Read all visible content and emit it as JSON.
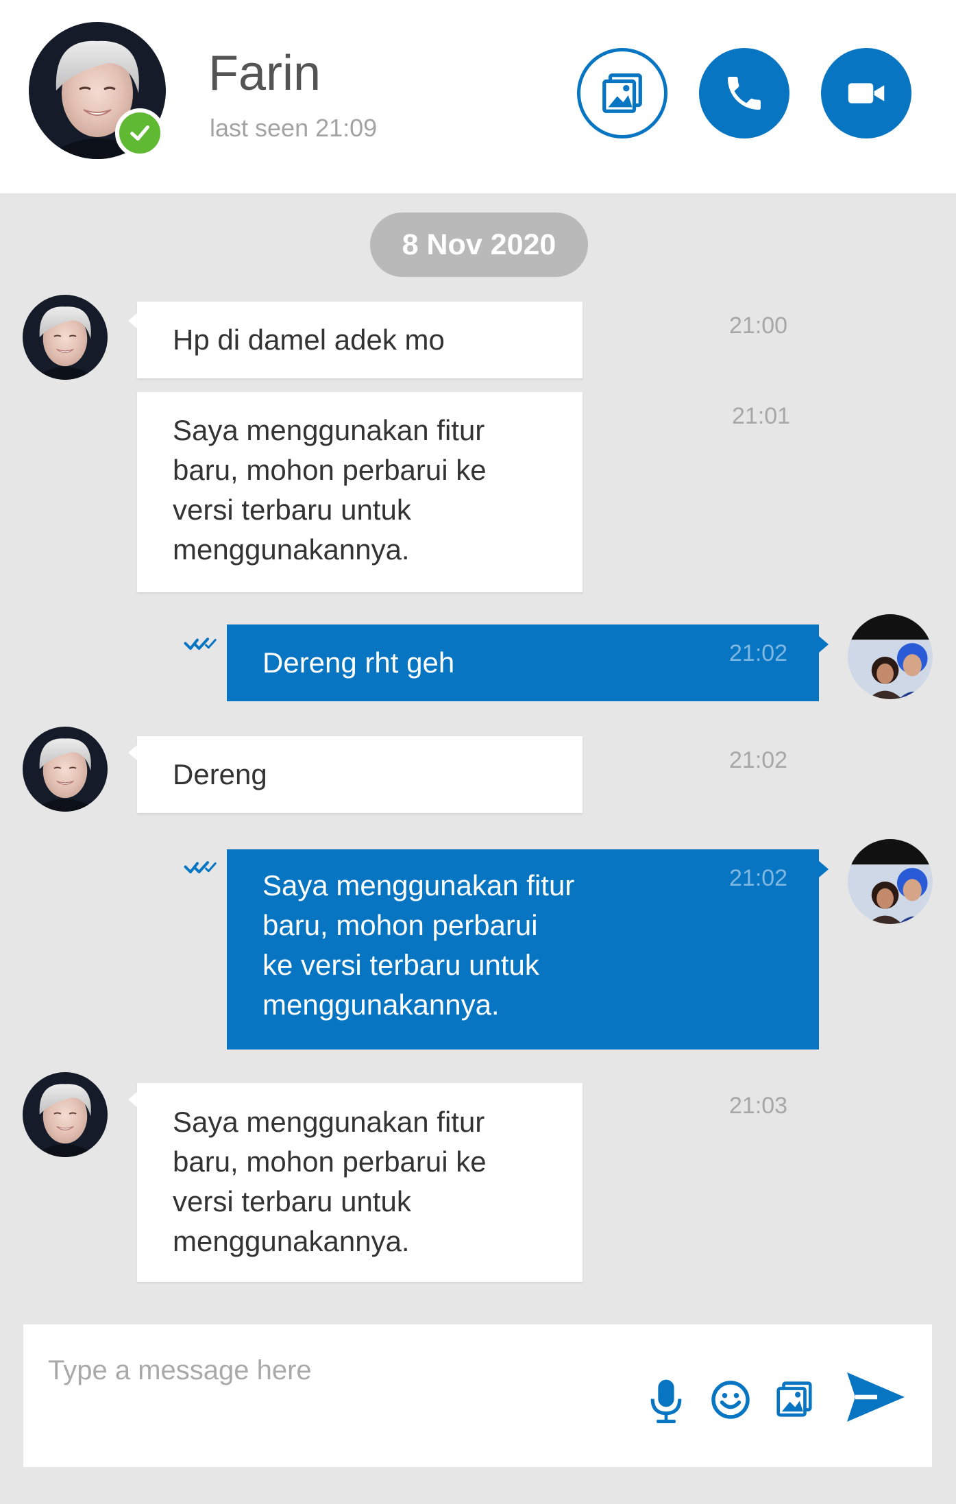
{
  "header": {
    "name": "Farin",
    "last_seen": "last seen 21:09",
    "online_status": "online",
    "buttons": [
      {
        "icon": "image-icon",
        "label": "Send image"
      },
      {
        "icon": "phone-icon",
        "label": "Voice call"
      },
      {
        "icon": "video-camera-icon",
        "label": "Video call"
      }
    ]
  },
  "chat": {
    "date": "8 Nov 2020",
    "messages": [
      {
        "direction": "in",
        "text": "Hp di damel adek mo",
        "time": "21:00"
      },
      {
        "direction": "in",
        "text": "Saya menggunakan fitur\nbaru, mohon perbarui ke\nversi terbaru untuk\nmenggunakannya.",
        "time": "21:01"
      },
      {
        "direction": "out",
        "text": "Dereng rht geh",
        "time": "21:02",
        "status": "read"
      },
      {
        "direction": "in",
        "text": "Dereng",
        "time": "21:02"
      },
      {
        "direction": "out",
        "text": "Saya menggunakan fitur\nbaru, mohon perbarui\nke versi terbaru untuk\nmenggunakannya.",
        "time": "21:02",
        "status": "read"
      },
      {
        "direction": "in",
        "text": "Saya menggunakan fitur\nbaru, mohon perbarui ke\nversi terbaru untuk\nmenggunakannya.",
        "time": "21:03"
      }
    ]
  },
  "composer": {
    "placeholder": "Type a message here",
    "value": "",
    "icons": [
      "microphone-icon",
      "emoji-icon",
      "image-icon",
      "send-icon"
    ]
  },
  "colors": {
    "accent": "#0775c2",
    "online": "#5fb932",
    "chat_bg": "#e6e6e6",
    "date_pill": "#b9b9b9"
  }
}
